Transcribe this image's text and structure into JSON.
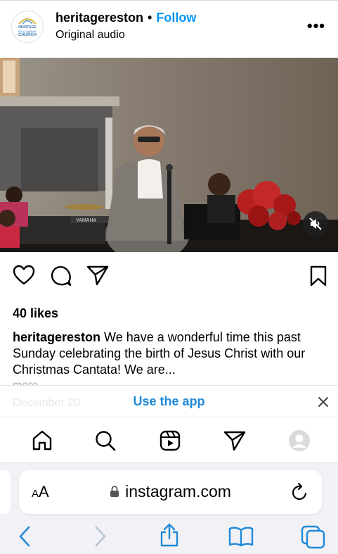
{
  "post": {
    "username": "heritagereston",
    "separator": "•",
    "follow_label": "Follow",
    "audio_label": "Original audio",
    "more_label": "•••",
    "avatar_text_line1": "HERITAGE",
    "avatar_text_line2": "FELLOWSHIP",
    "avatar_text_line3": "CHURCH",
    "likes": "40 likes",
    "caption_user": "heritagereston",
    "caption_text": " We have a wonderful time this past Sunday celebrating the birth of Jesus Christ with our Christmas Cantata! We are...",
    "more_text": "more",
    "date_text": "December 20"
  },
  "video": {
    "keyboard_brand": "YAMAHA"
  },
  "banner": {
    "use_app_label": "Use the app"
  },
  "browser": {
    "aa_small": "A",
    "aa_large": "A",
    "url": "instagram.com"
  },
  "colors": {
    "accent": "#0095f6",
    "safari_blue": "#1f8ad8",
    "toolbar_bg": "#f2f2f6"
  }
}
